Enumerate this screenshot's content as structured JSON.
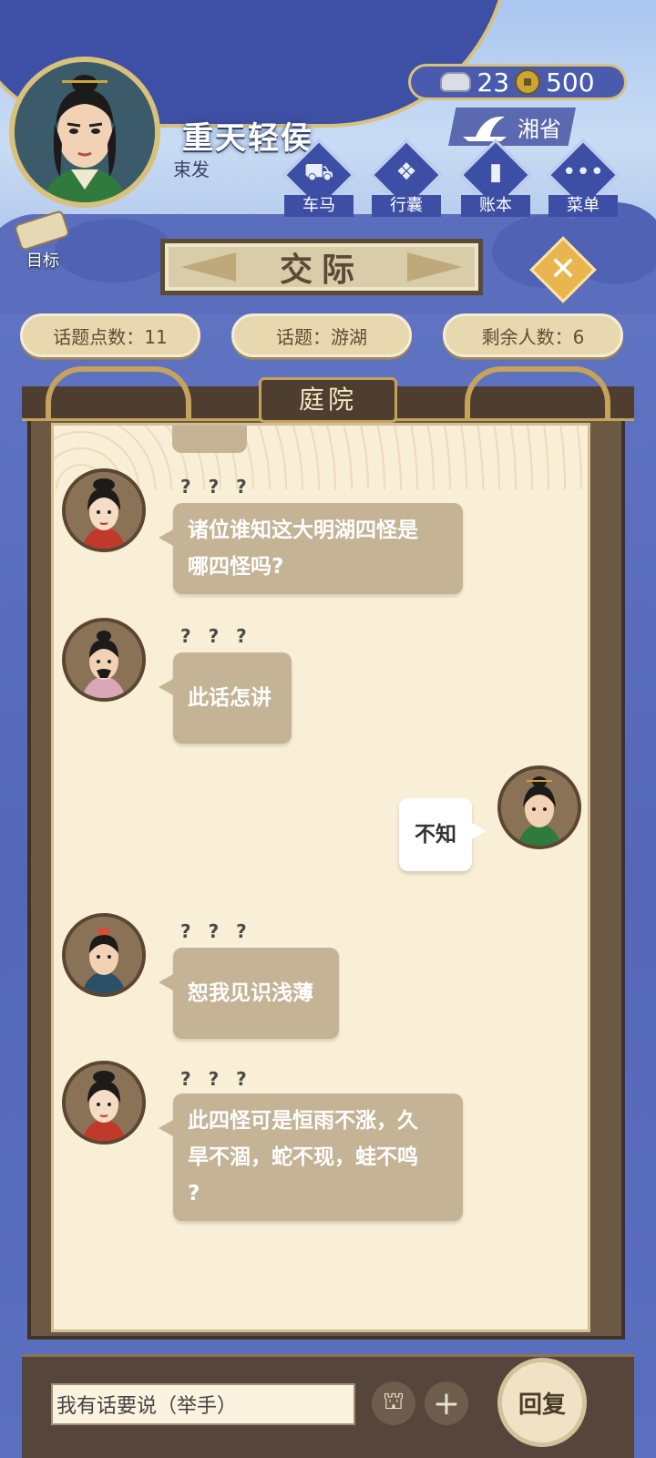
{
  "player": {
    "name": "重天轻侯",
    "title": "束发"
  },
  "currency": {
    "silver": "23",
    "copper": "500"
  },
  "region": "湘省",
  "nav": [
    {
      "label": "车马",
      "icon": "carriage-icon"
    },
    {
      "label": "行囊",
      "icon": "bundle-icon"
    },
    {
      "label": "账本",
      "icon": "ledger-icon"
    },
    {
      "label": "菜单",
      "icon": "menu-icon"
    }
  ],
  "target_label": "目标",
  "banner_title": "交际",
  "info": {
    "topic_points": "话题点数：11",
    "topic": "话题：游湖",
    "remaining": "剩余人数：6"
  },
  "place": "庭院",
  "messages": [
    {
      "speaker": "? ? ?",
      "text_lines": [
        "诸位谁知这大明湖四怪是",
        "哪四怪吗?"
      ],
      "side": "left"
    },
    {
      "speaker": "? ? ?",
      "text_lines": [
        "此话怎讲"
      ],
      "side": "left"
    },
    {
      "speaker": "",
      "text_lines": [
        "不知"
      ],
      "side": "right"
    },
    {
      "speaker": "? ? ?",
      "text_lines": [
        "恕我见识浅薄"
      ],
      "side": "left"
    },
    {
      "speaker": "? ? ?",
      "text_lines": [
        "此四怪可是恒雨不涨，久",
        "旱不涸，蛇不现，蛙不鸣",
        "?"
      ],
      "side": "left"
    }
  ],
  "input": {
    "value": "我有话要说（举手）"
  },
  "reply_label": "回复"
}
